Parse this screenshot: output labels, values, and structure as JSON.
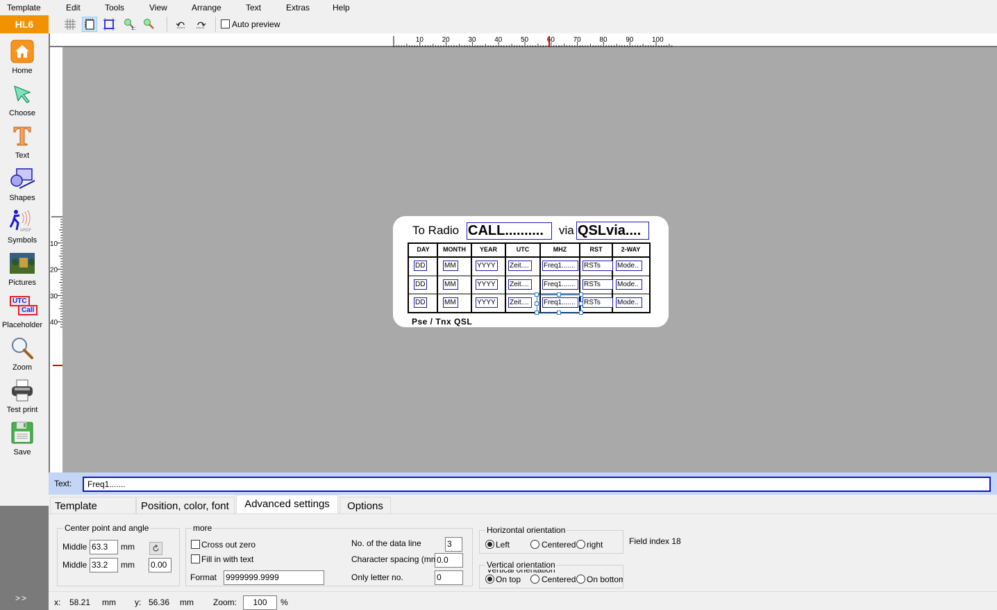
{
  "app": {
    "brand": "HL6"
  },
  "menu": [
    "Template",
    "Edit",
    "Tools",
    "View",
    "Arrange",
    "Text",
    "Extras",
    "Help"
  ],
  "toolbar": {
    "buttons": [
      "grid-icon",
      "margin-frame-icon",
      "frame-icon",
      "zoom-1to1-icon",
      "zoom-icon",
      "undo-icon",
      "redo-icon"
    ],
    "auto_preview_label": "Auto preview",
    "auto_preview_checked": false
  },
  "sidebar": {
    "items": [
      {
        "label": "Home",
        "icon": "home-icon"
      },
      {
        "label": "Choose",
        "icon": "cursor-arrow-icon"
      },
      {
        "label": "Text",
        "icon": "text-t-icon"
      },
      {
        "label": "Shapes",
        "icon": "shapes-icon"
      },
      {
        "label": "Symbols",
        "icon": "ardf-symbol-icon"
      },
      {
        "label": "Pictures",
        "icon": "picture-icon"
      },
      {
        "label": "Placeholder",
        "icon": "placeholder-icon"
      },
      {
        "label": "Zoom",
        "icon": "magnifier-icon"
      },
      {
        "label": "Test print",
        "icon": "printer-icon"
      },
      {
        "label": "Save",
        "icon": "floppy-save-icon"
      }
    ],
    "placeholder_icon_text": [
      "UTC",
      "Call"
    ],
    "expand_label": ">>"
  },
  "ruler": {
    "top_ticks": [
      "10",
      "20",
      "30",
      "40",
      "50",
      "60",
      "70",
      "80",
      "90",
      "100"
    ],
    "left_ticks": [
      "10",
      "20",
      "30",
      "40"
    ]
  },
  "card": {
    "to_radio": "To Radio",
    "call": "CALL..........",
    "via": "via",
    "qslvia": "QSLvia....",
    "headers": [
      "DAY",
      "MONTH",
      "YEAR",
      "UTC",
      "MHZ",
      "RST",
      "2-WAY"
    ],
    "rows": [
      [
        "DD",
        "MM",
        "YYYY",
        "Zeit....",
        "Freq1.......",
        "RSTs",
        "Mode.."
      ],
      [
        "DD",
        "MM",
        "YYYY",
        "Zeit....",
        "Freq1.......",
        "RSTs",
        "Mode.."
      ],
      [
        "DD",
        "MM",
        "YYYY",
        "Zeit....",
        "Freq1.......",
        "RSTs",
        "Mode.."
      ]
    ],
    "footer": "Pse / Tnx  QSL"
  },
  "textbar": {
    "label": "Text:",
    "value": "Freq1......."
  },
  "tabs": [
    {
      "label": "Template settings",
      "active": false
    },
    {
      "label": "Position, color, font",
      "active": false
    },
    {
      "label": "Advanced settings",
      "active": true
    },
    {
      "label": "Options",
      "active": false
    }
  ],
  "advanced": {
    "center": {
      "title": "Center point and angle",
      "middle_label": "Middle",
      "unit": "mm",
      "x_value": "63.3",
      "y_value": "33.2",
      "angle_value": "0.00"
    },
    "more": {
      "title": "more",
      "cross_out_zero": "Cross out zero",
      "fill_in_text": "Fill in with text",
      "format_label": "Format",
      "format_value": "9999999.9999",
      "data_line_label": "No. of the data line",
      "data_line_value": "3",
      "char_spacing_label": "Character spacing (mm",
      "char_spacing_value": "0.0",
      "only_letter_label": "Only letter no.",
      "only_letter_value": "0"
    },
    "horizontal": {
      "title": "Horizontal orientation",
      "options": [
        "Left",
        "Centered",
        "right"
      ],
      "selected": "Left"
    },
    "vertical": {
      "title": "Vertical orientation",
      "options": [
        "On top",
        "Centered",
        "On bottom"
      ],
      "selected": "On top"
    },
    "field_index": "Field index 18"
  },
  "status": {
    "x_label": "x:",
    "x_value": "58.21",
    "x_unit": "mm",
    "y_label": "y:",
    "y_value": "56.36",
    "y_unit": "mm",
    "zoom_label": "Zoom:",
    "zoom_value": "100",
    "zoom_unit": "%"
  },
  "colors": {
    "brand": "#f39200",
    "field_border": "#1a1aa6",
    "selection": "#1e78d0",
    "textbar_bg": "#c4d5f5"
  }
}
